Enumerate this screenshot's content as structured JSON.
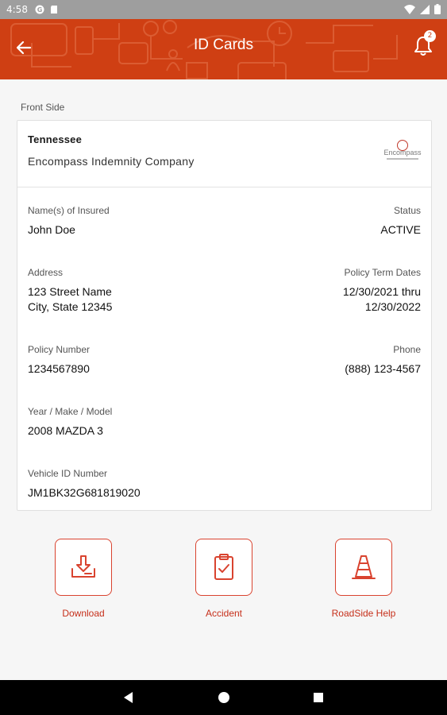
{
  "status_bar": {
    "time": "4:58",
    "icons": [
      "settings-g-icon",
      "sd-card-icon",
      "wifi-icon",
      "signal-icon",
      "battery-icon"
    ]
  },
  "app_bar": {
    "title": "ID Cards",
    "notification_count": "2",
    "icons": [
      "back-arrow-icon",
      "bell-icon"
    ],
    "color": "#cf3f13"
  },
  "card": {
    "section_label": "Front Side",
    "state": "Tennessee",
    "company": "Encompass Indemnity Company",
    "logo_text": "Encompass",
    "fields": {
      "insured_label": "Name(s) of Insured",
      "insured_value": "John Doe",
      "status_label": "Status",
      "status_value": "ACTIVE",
      "address_label": "Address",
      "address_line1": "123 Street Name",
      "address_line2": "City, State 12345",
      "term_label": "Policy Term Dates",
      "term_line1": "12/30/2021 thru",
      "term_line2": "12/30/2022",
      "policy_label": "Policy Number",
      "policy_value": "1234567890",
      "phone_label": "Phone",
      "phone_value": "(888) 123-4567",
      "ymm_label": "Year / Make / Model",
      "ymm_value": "2008 MAZDA 3",
      "vin_label": "Vehicle ID Number",
      "vin_value": "JM1BK32G681819020"
    }
  },
  "actions": [
    {
      "label": "Download",
      "icon": "download-icon"
    },
    {
      "label": "Accident",
      "icon": "clipboard-check-icon"
    },
    {
      "label": "RoadSide Help",
      "icon": "traffic-cone-icon"
    }
  ],
  "nav_bar": {
    "icons": [
      "back-triangle-icon",
      "home-circle-icon",
      "recents-square-icon"
    ]
  }
}
